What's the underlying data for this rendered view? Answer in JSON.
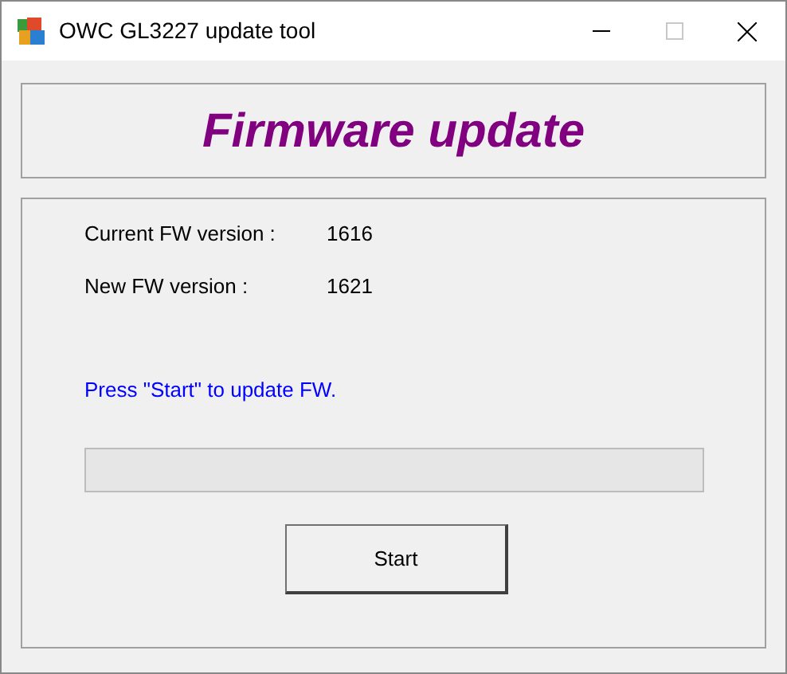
{
  "window": {
    "title": "OWC GL3227 update tool"
  },
  "header": {
    "title": "Firmware update"
  },
  "versions": [
    {
      "label": "Current FW version :",
      "value": "1616"
    },
    {
      "label": "New FW version :",
      "value": "1621"
    }
  ],
  "status": {
    "text": "Press \"Start\" to update FW."
  },
  "progress": {
    "level": 0
  },
  "buttons": [
    "Start"
  ]
}
